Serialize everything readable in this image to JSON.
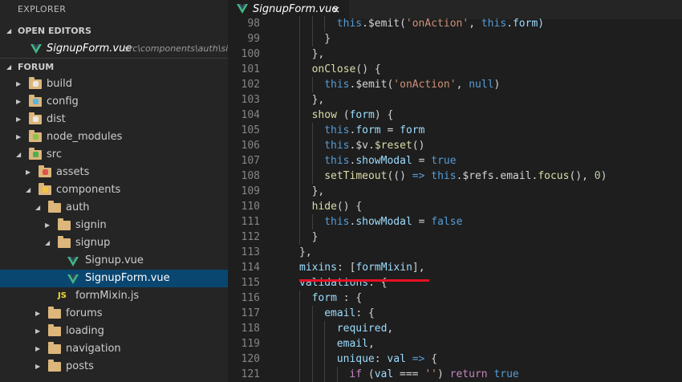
{
  "sidebar": {
    "title": "EXPLORER",
    "open_editors_label": "OPEN EDITORS",
    "open_editor": {
      "name": "SignupForm.vue",
      "path": "src\\components\\auth\\si..."
    },
    "project_label": "FORUM",
    "tree": [
      {
        "label": "build",
        "depth": 1,
        "expanded": false,
        "icon": "folder-build"
      },
      {
        "label": "config",
        "depth": 1,
        "expanded": false,
        "icon": "folder-config"
      },
      {
        "label": "dist",
        "depth": 1,
        "expanded": false,
        "icon": "folder-dist"
      },
      {
        "label": "node_modules",
        "depth": 1,
        "expanded": false,
        "icon": "folder-node"
      },
      {
        "label": "src",
        "depth": 1,
        "expanded": true,
        "icon": "folder-src"
      },
      {
        "label": "assets",
        "depth": 2,
        "expanded": false,
        "icon": "folder-assets"
      },
      {
        "label": "components",
        "depth": 2,
        "expanded": true,
        "icon": "folder-components"
      },
      {
        "label": "auth",
        "depth": 3,
        "expanded": true,
        "icon": "folder"
      },
      {
        "label": "signin",
        "depth": 4,
        "expanded": false,
        "icon": "folder"
      },
      {
        "label": "signup",
        "depth": 4,
        "expanded": true,
        "icon": "folder"
      },
      {
        "label": "Signup.vue",
        "depth": 5,
        "file": true,
        "icon": "vue"
      },
      {
        "label": "SignupForm.vue",
        "depth": 5,
        "file": true,
        "icon": "vue",
        "selected": true
      },
      {
        "label": "formMixin.js",
        "depth": 4,
        "file": true,
        "icon": "js"
      },
      {
        "label": "forums",
        "depth": 3,
        "expanded": false,
        "icon": "folder"
      },
      {
        "label": "loading",
        "depth": 3,
        "expanded": false,
        "icon": "folder"
      },
      {
        "label": "navigation",
        "depth": 3,
        "expanded": false,
        "icon": "folder"
      },
      {
        "label": "posts",
        "depth": 3,
        "expanded": false,
        "icon": "folder"
      }
    ]
  },
  "editor": {
    "tab": {
      "name": "SignupForm.vue",
      "close": "×"
    },
    "lines": [
      {
        "n": "98",
        "indent": 3,
        "tokens": [
          [
            "this",
            "k-this"
          ],
          [
            ".$emit(",
            "k-plain"
          ],
          [
            "'onAction'",
            "k-str"
          ],
          [
            ", ",
            "k-plain"
          ],
          [
            "this",
            "k-this"
          ],
          [
            ".form)",
            "k-prop"
          ]
        ]
      },
      {
        "n": "99",
        "indent": 2,
        "tokens": [
          [
            "}",
            "k-plain"
          ]
        ]
      },
      {
        "n": "100",
        "indent": 1,
        "tokens": [
          [
            "},",
            "k-plain"
          ]
        ]
      },
      {
        "n": "101",
        "indent": 1,
        "tokens": [
          [
            "onClose",
            "k-fn"
          ],
          [
            "() {",
            "k-plain"
          ]
        ]
      },
      {
        "n": "102",
        "indent": 2,
        "tokens": [
          [
            "this",
            "k-this"
          ],
          [
            ".$emit(",
            "k-plain"
          ],
          [
            "'onAction'",
            "k-str"
          ],
          [
            ", ",
            "k-plain"
          ],
          [
            "null",
            "k-kw"
          ],
          [
            ")",
            "k-plain"
          ]
        ]
      },
      {
        "n": "103",
        "indent": 1,
        "tokens": [
          [
            "},",
            "k-plain"
          ]
        ]
      },
      {
        "n": "104",
        "indent": 1,
        "tokens": [
          [
            "show",
            "k-fn"
          ],
          [
            " (",
            "k-plain"
          ],
          [
            "form",
            "k-prop"
          ],
          [
            ") {",
            "k-plain"
          ]
        ]
      },
      {
        "n": "105",
        "indent": 2,
        "tokens": [
          [
            "this",
            "k-this"
          ],
          [
            ".",
            "k-plain"
          ],
          [
            "form",
            "k-prop"
          ],
          [
            " = ",
            "k-plain"
          ],
          [
            "form",
            "k-prop"
          ]
        ]
      },
      {
        "n": "106",
        "indent": 2,
        "tokens": [
          [
            "this",
            "k-this"
          ],
          [
            ".$v.",
            "k-plain"
          ],
          [
            "$reset",
            "k-fn"
          ],
          [
            "()",
            "k-plain"
          ]
        ]
      },
      {
        "n": "107",
        "indent": 2,
        "tokens": [
          [
            "this",
            "k-this"
          ],
          [
            ".",
            "k-plain"
          ],
          [
            "showModal",
            "k-prop"
          ],
          [
            " = ",
            "k-plain"
          ],
          [
            "true",
            "k-kw"
          ]
        ]
      },
      {
        "n": "108",
        "indent": 2,
        "tokens": [
          [
            "setTimeout",
            "k-fn"
          ],
          [
            "(() ",
            "k-plain"
          ],
          [
            "=>",
            "k-kw"
          ],
          [
            " ",
            "k-plain"
          ],
          [
            "this",
            "k-this"
          ],
          [
            ".$refs.email.",
            "k-plain"
          ],
          [
            "focus",
            "k-fn"
          ],
          [
            "(), ",
            "k-plain"
          ],
          [
            "0",
            "k-num"
          ],
          [
            ")",
            "k-plain"
          ]
        ]
      },
      {
        "n": "109",
        "indent": 1,
        "tokens": [
          [
            "},",
            "k-plain"
          ]
        ]
      },
      {
        "n": "110",
        "indent": 1,
        "tokens": [
          [
            "hide",
            "k-fn"
          ],
          [
            "() {",
            "k-plain"
          ]
        ]
      },
      {
        "n": "111",
        "indent": 2,
        "tokens": [
          [
            "this",
            "k-this"
          ],
          [
            ".",
            "k-plain"
          ],
          [
            "showModal",
            "k-prop"
          ],
          [
            " = ",
            "k-plain"
          ],
          [
            "false",
            "k-kw"
          ]
        ]
      },
      {
        "n": "112",
        "indent": 1,
        "tokens": [
          [
            "}",
            "k-plain"
          ]
        ]
      },
      {
        "n": "113",
        "indent": 0,
        "tokens": [
          [
            "},",
            "k-plain"
          ]
        ]
      },
      {
        "n": "114",
        "indent": 0,
        "tokens": [
          [
            "mixins",
            "k-prop"
          ],
          [
            ": [",
            "k-plain"
          ],
          [
            "formMixin",
            "k-prop"
          ],
          [
            "],",
            "k-plain"
          ]
        ]
      },
      {
        "n": "115",
        "indent": 0,
        "tokens": [
          [
            "validations",
            "k-prop"
          ],
          [
            ": {",
            "k-plain"
          ]
        ]
      },
      {
        "n": "116",
        "indent": 1,
        "tokens": [
          [
            "form",
            "k-prop"
          ],
          [
            " : {",
            "k-plain"
          ]
        ]
      },
      {
        "n": "117",
        "indent": 2,
        "tokens": [
          [
            "email",
            "k-prop"
          ],
          [
            ": {",
            "k-plain"
          ]
        ]
      },
      {
        "n": "118",
        "indent": 3,
        "tokens": [
          [
            "required",
            "k-prop"
          ],
          [
            ",",
            "k-plain"
          ]
        ]
      },
      {
        "n": "119",
        "indent": 3,
        "tokens": [
          [
            "email",
            "k-prop"
          ],
          [
            ",",
            "k-plain"
          ]
        ]
      },
      {
        "n": "120",
        "indent": 3,
        "tokens": [
          [
            "unique",
            "k-prop"
          ],
          [
            ": ",
            "k-plain"
          ],
          [
            "val",
            "k-prop"
          ],
          [
            " ",
            "k-plain"
          ],
          [
            "=>",
            "k-kw"
          ],
          [
            " {",
            "k-plain"
          ]
        ]
      },
      {
        "n": "121",
        "indent": 4,
        "tokens": [
          [
            "if",
            "k-ctrl"
          ],
          [
            " (",
            "k-plain"
          ],
          [
            "val",
            "k-prop"
          ],
          [
            " === ",
            "k-plain"
          ],
          [
            "''",
            "k-str"
          ],
          [
            ") ",
            "k-plain"
          ],
          [
            "return",
            "k-ctrl"
          ],
          [
            " ",
            "k-plain"
          ],
          [
            "true",
            "k-kw"
          ]
        ]
      }
    ]
  },
  "colors": {
    "vue_green": "#41b883",
    "vue_dark": "#35495e",
    "highlight_underline": "#e81123",
    "selection": "#094771"
  }
}
